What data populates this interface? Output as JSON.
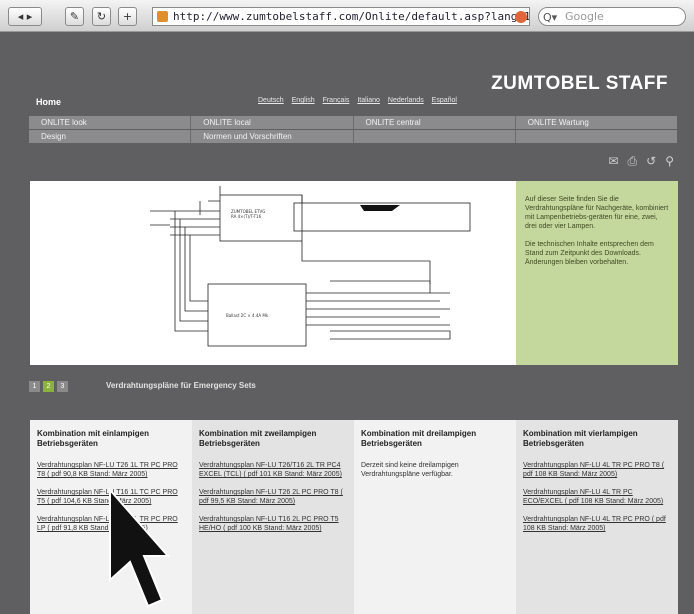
{
  "browser": {
    "back_label": "◂",
    "forward_label": "▸",
    "url": "http://www.zumtobelstaff.com/Onlite/default.asp?lang=1&page=2338",
    "search_placeholder": "Google"
  },
  "header": {
    "brand": "ZUMTOBEL STAFF",
    "home": "Home",
    "languages": [
      "Deutsch",
      "English",
      "Français",
      "Italiano",
      "Nederlands",
      "Español"
    ]
  },
  "nav": {
    "row1": [
      "ONLITE look",
      "ONLITE local",
      "ONLITE central",
      "ONLITE Wartung"
    ],
    "row2": [
      "Design",
      "Normen und Vorschriften",
      "",
      ""
    ]
  },
  "sidebox": {
    "p1": "Auf dieser Seite finden Sie die Verdrahtungspläne für Nachgeräte, kombiniert mit Lampenbetriebs-geräten für eine, zwei, drei oder vier Lampen.",
    "p2": "Die technischen Inhalte entsprechen dem Stand zum Zeitpunkt des Downloads. Änderungen bleiben vorbehalten."
  },
  "pager": [
    "1",
    "2",
    "3"
  ],
  "section_title": "Verdrahtungspläne für Emergency Sets",
  "columns": [
    {
      "heading": "Kombination mit einlampigen Betriebsgeräten",
      "links": [
        "Verdrahtungsplan NF-LU T26 1L TR PC PRO T8 ( pdf 90,8 KB Stand: März 2005)",
        "Verdrahtungsplan NF-LU T16 1L TC PC PRO T5 ( pdf 104,6 KB Stand: März 2005)",
        "Verdrahtungsplan NF-LU T26 1L TR PC PRO LP ( pdf 91,8 KB Stand: März 2005)"
      ]
    },
    {
      "heading": "Kombination mit zweilampigen Betriebsgeräten",
      "links": [
        "Verdrahtungsplan NF-LU T26/T16 2L TR PC4 EXCEL (TCL) ( pdf 101 KB Stand: März 2005)",
        "Verdrahtungsplan NF-LU T26 2L PC PRO T8 ( pdf 99,5 KB Stand: März 2005)",
        "Verdrahtungsplan NF-LU T16 2L PC PRO T5 HE/HO ( pdf 100 KB Stand: März 2005)"
      ]
    },
    {
      "heading": "Kombination mit dreilampigen Betriebsgeräten",
      "text": "Derzeit sind keine dreilampigen Verdrahtungspläne verfügbar."
    },
    {
      "heading": "Kombination mit vierlampigen Betriebsgeräten",
      "links": [
        "Verdrahtungsplan NF-LU 4L TR PC PRO T8 ( pdf 108 KB Stand: März 2005)",
        "Verdrahtungsplan NF-LU 4L TR PC ECO/EXCEL ( pdf 108 KB Stand: März 2005)",
        "Verdrahtungsplan NF-LU 4L TR PC PRO ( pdf 108 KB Stand: März 2005)"
      ]
    }
  ],
  "diagram": {
    "box1_label": "ZUMTOBEL ETVG\nRA 4×(T)/T-T16",
    "box2_label": "Ballast 2C × 4.4A Mk"
  },
  "colors": {
    "accent_green": "#c4d79c",
    "page_bg": "#5f5f61"
  }
}
